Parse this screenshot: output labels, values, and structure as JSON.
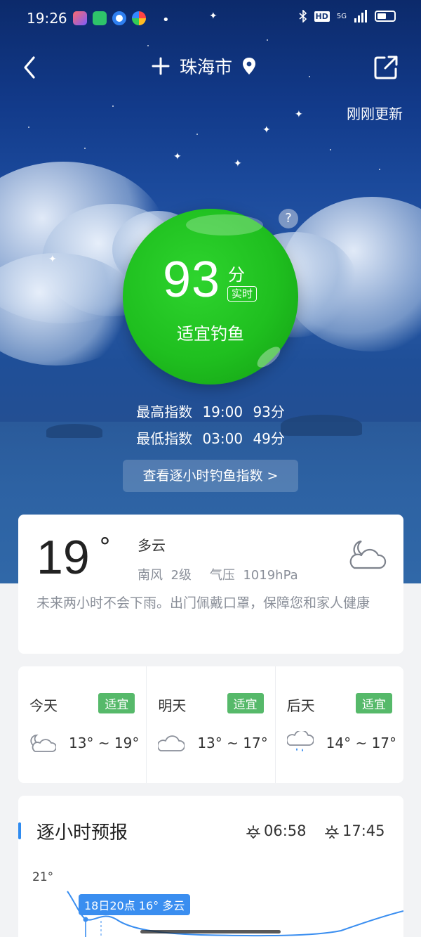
{
  "status": {
    "time": "19:26",
    "network": "5G",
    "hd": "HD",
    "bluetooth_icon": "bluetooth-icon"
  },
  "header": {
    "city": "珠海市",
    "update": "刚刚更新"
  },
  "score": {
    "value": "93",
    "unit": "分",
    "tag": "实时",
    "label": "适宜钓鱼",
    "help": "?"
  },
  "index": {
    "max_label": "最高指数",
    "max_time": "19:00",
    "max_value": "93分",
    "min_label": "最低指数",
    "min_time": "03:00",
    "min_value": "49分"
  },
  "hourly_link": "查看逐小时钓鱼指数 >",
  "weather": {
    "temp": "19",
    "deg": "°",
    "condition": "多云",
    "wind": "南风",
    "wind_level": "2级",
    "pressure_label": "气压",
    "pressure": "1019hPa",
    "advice": "未来两小时不会下雨。出门佩戴口罩，保障您和家人健康"
  },
  "days": [
    {
      "name": "今天",
      "badge": "适宜",
      "range": "13° ~ 19°",
      "icon": "partly-cloudy-icon"
    },
    {
      "name": "明天",
      "badge": "适宜",
      "range": "13° ~ 17°",
      "icon": "cloud-icon"
    },
    {
      "name": "后天",
      "badge": "适宜",
      "range": "14° ~ 17°",
      "icon": "rain-cloud-icon"
    }
  ],
  "hourly": {
    "title": "逐小时预报",
    "sunrise": "06:58",
    "sunset": "17:45",
    "y_max": "21°",
    "tooltip": "18日20点 16° 多云"
  },
  "colors": {
    "ball": "#1fbf1f",
    "badge": "#56b96a",
    "accent": "#2f8bf0"
  }
}
